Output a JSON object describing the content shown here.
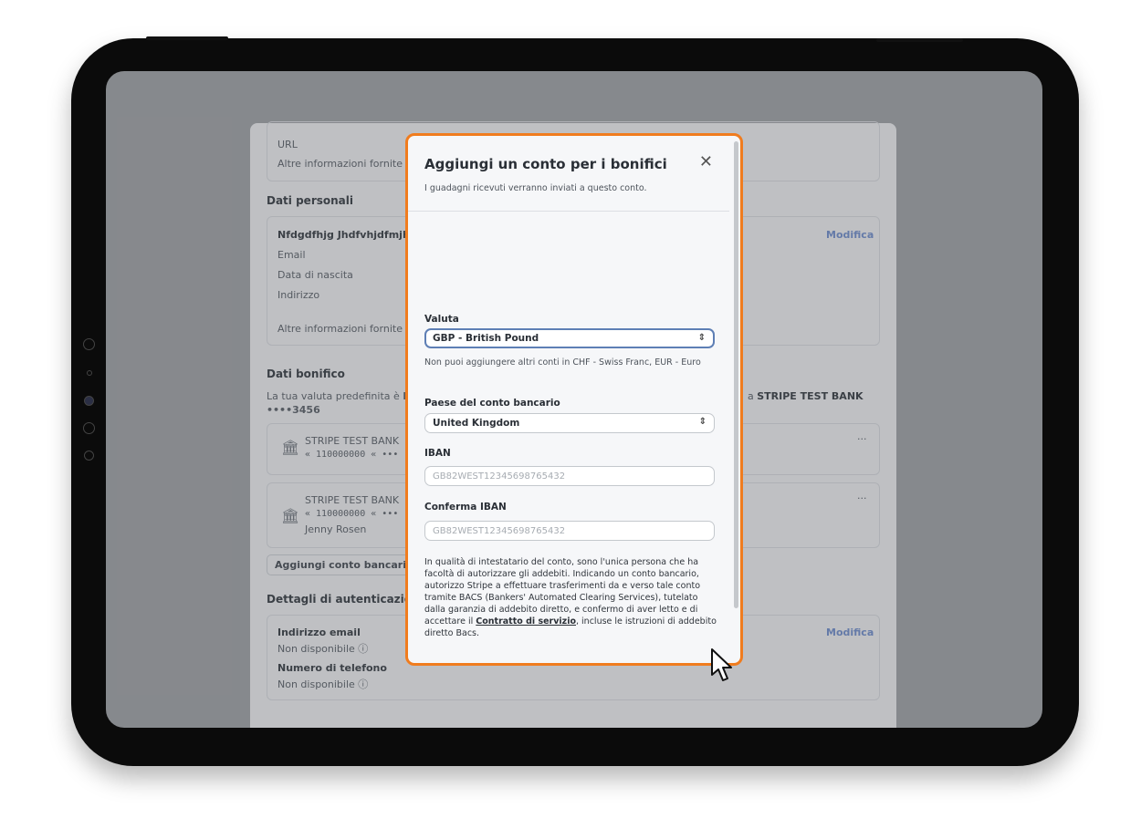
{
  "background": {
    "url_label": "URL",
    "other_info_1": "Altre informazioni fornite",
    "personal_heading": "Dati personali",
    "person_name": "Nfdgdfhjg Jhdfvhjdfmjhv",
    "email_label": "Email",
    "dob_label": "Data di nascita",
    "address_label": "Indirizzo",
    "other_info_2": "Altre informazioni fornite",
    "edit_label_1": "Modifica",
    "payout_heading": "Dati bonifico",
    "default_currency_prefix": "La tua valuta predefinita è",
    "default_currency_code": "EU",
    "default_currency_suffix": "a",
    "bank_ref": "STRIPE TEST BANK",
    "masked_ref": "••••3456",
    "bank_1_name": "STRIPE TEST BANK",
    "bank_1_number": "« 110000000 « •••",
    "bank_2_name": "STRIPE TEST BANK",
    "bank_2_number": "« 110000000 « •••",
    "bank_2_owner": "Jenny Rosen",
    "more_1": "···",
    "more_2": "···",
    "add_bank_label": "Aggiungi conto bancario",
    "auth_heading": "Dettagli di autenticazion",
    "auth_email_label": "Indirizzo email",
    "auth_email_value": "Non disponibile ⓘ",
    "auth_phone_label": "Numero di telefono",
    "auth_phone_value": "Non disponibile ⓘ",
    "edit_label_2": "Modifica"
  },
  "modal": {
    "title": "Aggiungi un conto per i bonifici",
    "subtitle": "I guadagni ricevuti verranno inviati a questo conto.",
    "close_icon": "✕",
    "currency_label": "Valuta",
    "currency_value": "GBP - British Pound",
    "currency_note": "Non puoi aggiungere altri conti in CHF - Swiss Franc, EUR - Euro",
    "country_label": "Paese del conto bancario",
    "country_value": "United Kingdom",
    "iban_label": "IBAN",
    "iban_placeholder": "GB82WEST12345698765432",
    "confirm_iban_label": "Conferma IBAN",
    "confirm_iban_placeholder": "GB82WEST12345698765432",
    "legal_text_before": "In qualità di intestatario del conto, sono l'unica persona che ha facoltà di autorizzare gli addebiti. Indicando un conto bancario, autorizzo Stripe a effettuare trasferimenti da e verso tale conto tramite BACS (Bankers' Automated Clearing Services), tutelato dalla garanzia di addebito diretto, e confermo di aver letto e di accettare il",
    "legal_link": "Contratto di servizio",
    "legal_text_after": ", incluse le istruzioni di addebito diretto Bacs.",
    "chevron_icon": "⌃⌄"
  },
  "colors": {
    "accent_border": "#f07c1e",
    "link": "#6b82b3",
    "focus": "#5e7fb5"
  }
}
